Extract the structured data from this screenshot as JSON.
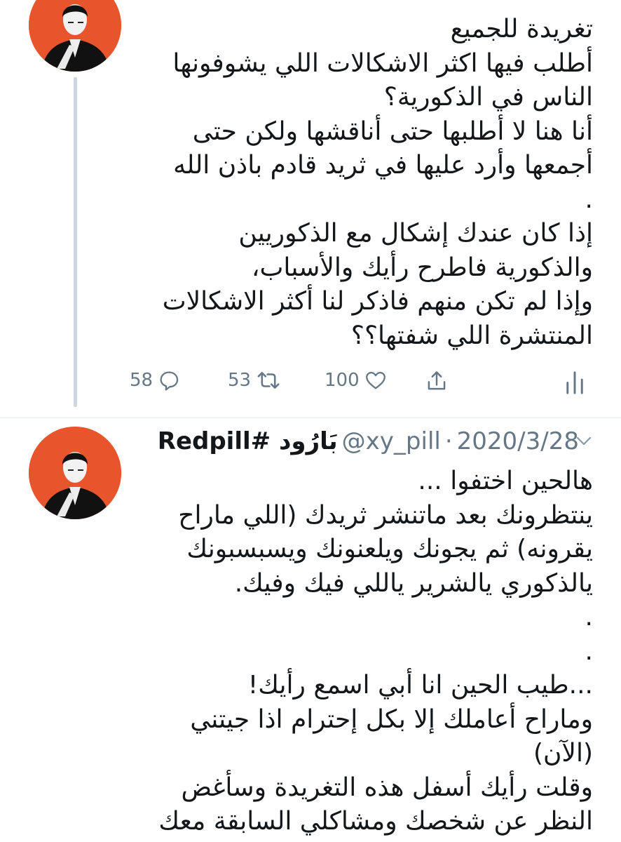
{
  "tweet1": {
    "text": "تغريدة للجميع\nأطلب فيها اكثر الاشكالات اللي يشوفونها الناس في الذكورية؟\nأنا هنا لا أطلبها حتى أناقشها ولكن حتى أجمعها وأرد عليها في ثريد قادم باذن الله\n.\nإذا كان عندك إشكال مع الذكوريين والذكورية فاطرح رأيك والأسباب،\nوإذا لم تكن منهم فاذكر لنا أكثر الاشكالات المنتشرة اللي شفتها؟؟",
    "replies": "58",
    "retweets": "53",
    "likes": "100"
  },
  "tweet2": {
    "author_name": "بَارُود #Redpill",
    "handle": "@xy_pill",
    "separator": "·",
    "date": "2020/3/28",
    "text": "هالحين اختفوا ...\nينتظرونك بعد ماتنشر ثريدك (اللي ماراح يقرونه) ثم يجونك ويلعنونك ويسبسبونك يالذكوري يالشرير ياللي فيك وفيك.\n.\n.\n...طيب الحين انا أبي اسمع رأيك!\nوماراح أعاملك إلا بكل إحترام اذا جيتني (الآن)\nوقلت رأيك أسفل هذه التغريدة وسأغض النظر عن شخصك ومشاكلي السابقة معك"
  },
  "icons": {
    "reply": "reply-bubble-icon",
    "retweet": "retweet-icon",
    "like": "heart-icon",
    "share": "share-icon",
    "analytics": "analytics-icon",
    "more": "chevron-down-icon"
  },
  "colors": {
    "avatar_bg": "#e8552d",
    "thread_line": "#ccd6dd",
    "meta_text": "#657786",
    "text": "#14171a"
  }
}
